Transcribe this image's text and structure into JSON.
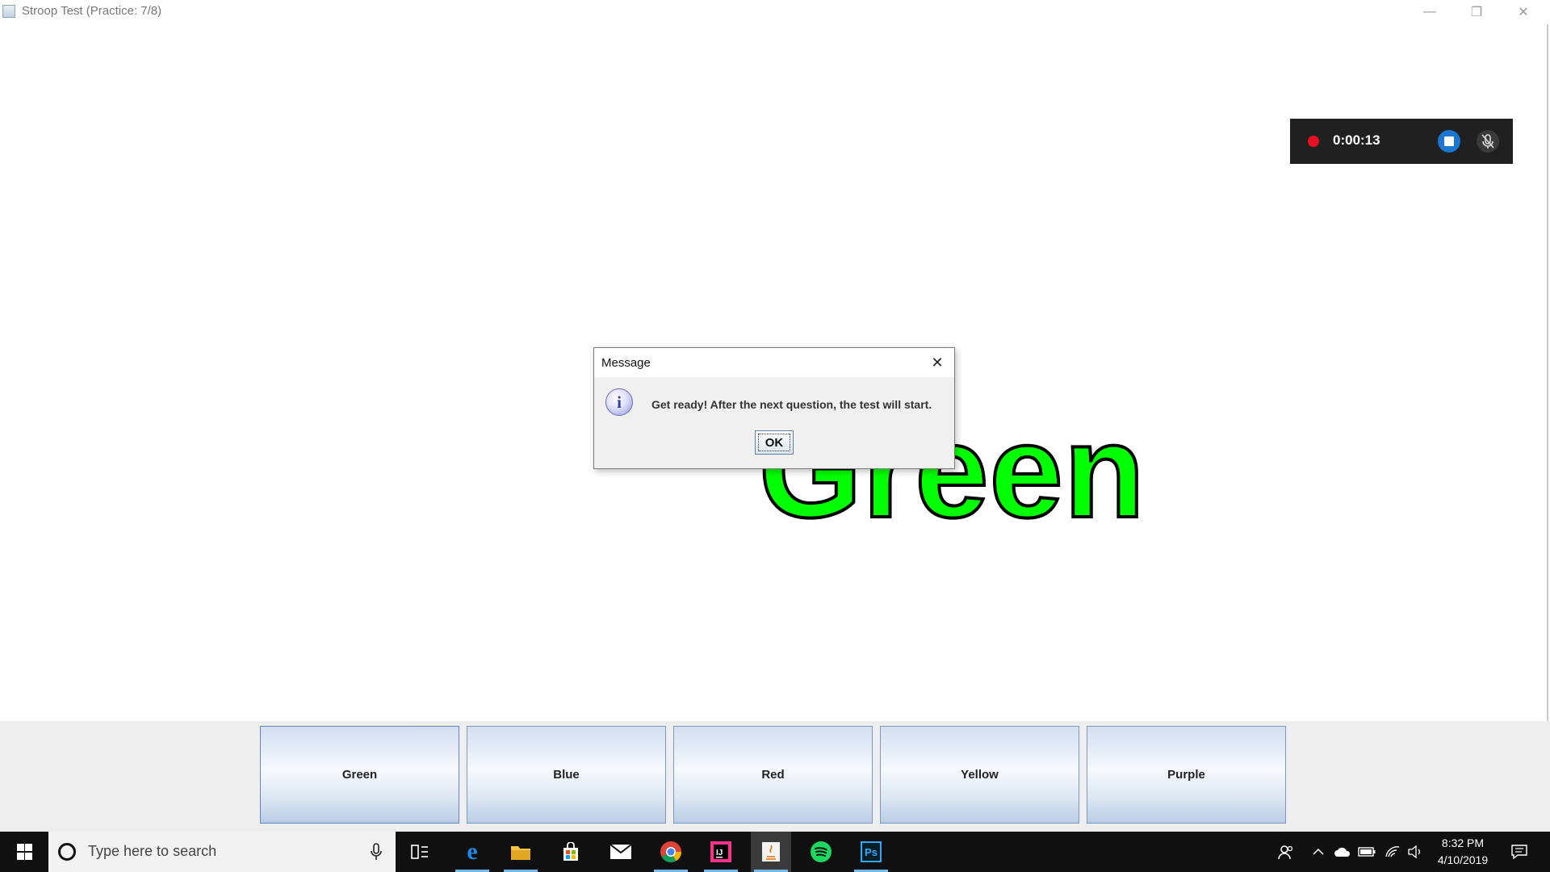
{
  "window": {
    "title": "Stroop Test (Practice: 7/8)",
    "minimize_glyph": "—",
    "maximize_glyph": "❐",
    "close_glyph": "✕"
  },
  "recorder": {
    "elapsed": "0:00:13"
  },
  "stimulus": {
    "word": "Green",
    "ink_color": "#00ff00"
  },
  "dialog": {
    "title": "Message",
    "icon_glyph": "i",
    "message": "Get ready! After the next question, the test will start.",
    "ok_label": "OK",
    "close_glyph": "✕"
  },
  "answers": [
    {
      "label": "Green"
    },
    {
      "label": "Blue"
    },
    {
      "label": "Red"
    },
    {
      "label": "Yellow"
    },
    {
      "label": "Purple"
    }
  ],
  "taskbar": {
    "search_placeholder": "Type here to search",
    "clock_time": "8:32 PM",
    "clock_date": "4/10/2019",
    "apps": [
      "task-view",
      "edge",
      "file-explorer",
      "store",
      "mail",
      "chrome",
      "intellij",
      "java",
      "spotify",
      "photoshop"
    ],
    "photoshop_label": "Ps"
  },
  "colors": {
    "accent": "#1976d2",
    "record": "#e81123",
    "taskbar": "#101010"
  }
}
